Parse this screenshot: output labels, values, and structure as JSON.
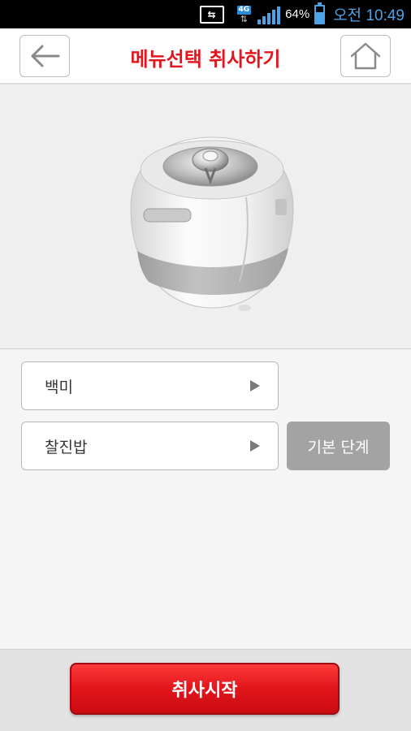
{
  "status_bar": {
    "nfc_label": "⇆",
    "network_type": "4G",
    "network_arrows": "⇅",
    "signal_bars": 5,
    "battery_percent": "64%",
    "battery_level": 0.64,
    "time": "오전 10:49",
    "accent_color": "#4da3e8"
  },
  "header": {
    "title": "메뉴선택 취사하기",
    "back_icon": "back-arrow-icon",
    "home_icon": "home-icon",
    "title_color": "#e3161f"
  },
  "product_image": {
    "description_icon": "rice-cooker-image"
  },
  "menu": {
    "rice_type": "백미",
    "cook_mode": "찰진밥",
    "basic_step_label": "기본 단계"
  },
  "footer": {
    "start_label": "취사시작",
    "start_color": "#e1151b"
  }
}
